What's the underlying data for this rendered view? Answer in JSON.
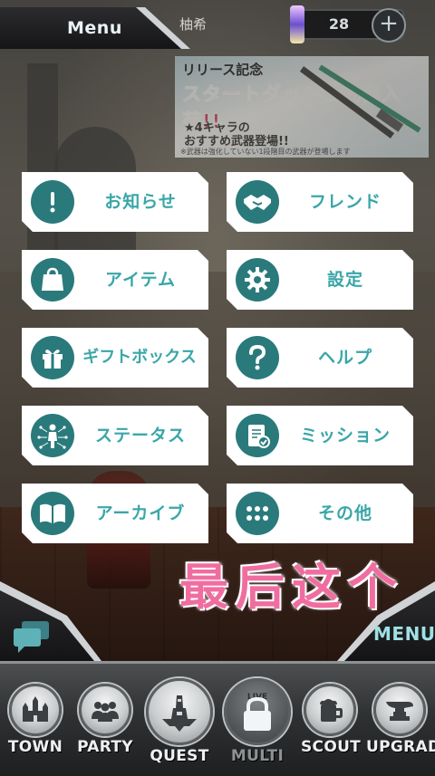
{
  "header": {
    "menu_title": "Menu",
    "player_name_fragment": "柚希",
    "currency_value": "28",
    "currency_add": "+"
  },
  "banner": {
    "title": "リリース記念",
    "headline": "スタートダッシュ武器入荷!!",
    "sub_line_1": "★4キャラの",
    "sub_line_2": "おすすめ武器登場!!",
    "note": "※武器は強化していない1段階目の武器が登場します"
  },
  "menu": {
    "items": [
      {
        "label": "お知らせ",
        "icon": "exclamation-icon"
      },
      {
        "label": "フレンド",
        "icon": "handshake-icon"
      },
      {
        "label": "アイテム",
        "icon": "bag-icon"
      },
      {
        "label": "設定",
        "icon": "gear-icon"
      },
      {
        "label": "ギフトボックス",
        "icon": "gift-icon"
      },
      {
        "label": "ヘルプ",
        "icon": "question-icon"
      },
      {
        "label": "ステータス",
        "icon": "person-status-icon"
      },
      {
        "label": "ミッション",
        "icon": "clipboard-check-icon"
      },
      {
        "label": "アーカイブ",
        "icon": "book-icon"
      },
      {
        "label": "その他",
        "icon": "dots-grid-icon"
      }
    ]
  },
  "annotation": "最后这个",
  "corners": {
    "chat_icon": "chat-bubbles-icon",
    "menu_label": "MENU"
  },
  "bottom_nav": {
    "items": [
      {
        "label": "TOWN",
        "icon": "town-icon"
      },
      {
        "label": "PARTY",
        "icon": "party-icon"
      },
      {
        "label": "QUEST",
        "icon": "quest-icon"
      },
      {
        "label": "MULTI",
        "icon": "lock-icon",
        "badge": "LIVE",
        "locked": true
      },
      {
        "label": "SCOUT",
        "icon": "mug-icon"
      },
      {
        "label": "UPGRADE",
        "icon": "anvil-icon"
      }
    ]
  },
  "colors": {
    "accent_teal": "#2a7a7c",
    "label_teal": "#3aa6a8",
    "annotation_pink": "#f06d9f"
  }
}
